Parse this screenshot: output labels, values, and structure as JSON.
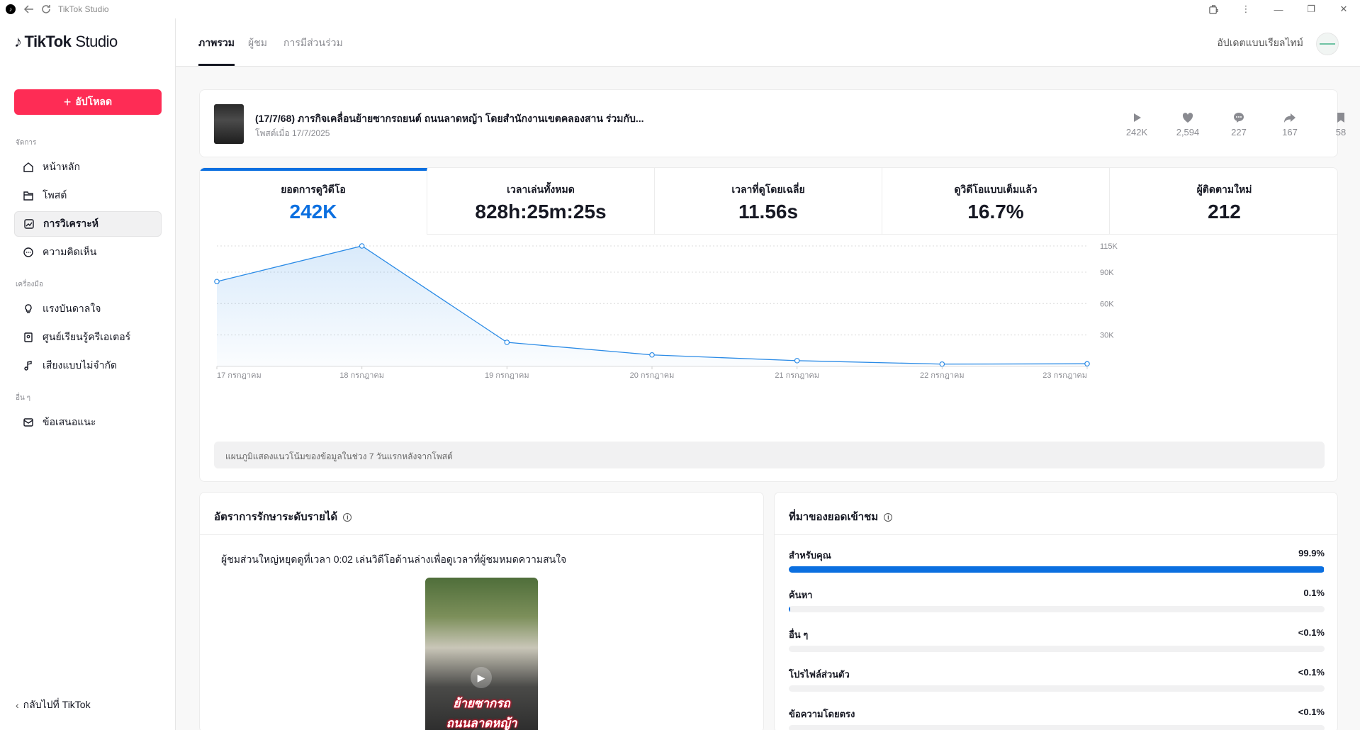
{
  "window": {
    "title": "TikTok Studio"
  },
  "sidebar": {
    "brand_main": "TikTok",
    "brand_sub": "Studio",
    "upload_label": "อัปโหลด",
    "section_manage": "จัดการ",
    "section_tools": "เครื่องมือ",
    "section_other": "อื่น ๆ",
    "items": [
      {
        "label": "หน้าหลัก"
      },
      {
        "label": "โพสต์"
      },
      {
        "label": "การวิเคราะห์"
      },
      {
        "label": "ความคิดเห็น"
      },
      {
        "label": "แรงบันดาลใจ"
      },
      {
        "label": "ศูนย์เรียนรู้ครีเอเตอร์"
      },
      {
        "label": "เสียงแบบไม่จำกัด"
      },
      {
        "label": "ข้อเสนอแนะ"
      }
    ],
    "back_label": "กลับไปที่ TikTok"
  },
  "topnav": {
    "tabs": [
      {
        "label": "ภาพรวม"
      },
      {
        "label": "ผู้ชม"
      },
      {
        "label": "การมีส่วนร่วม"
      }
    ],
    "live_update": "อัปเดตแบบเรียลไทม์"
  },
  "post": {
    "title": "(17/7/68) ภารกิจเคลื่อนย้ายซากรถยนต์ ถนนลาดหญ้า โดยสำนักงานเขตคลองสาน ร่วมกับ...",
    "date": "โพสต์เมื่อ 17/7/2025",
    "stats": {
      "views": "242K",
      "likes": "2,594",
      "comments": "227",
      "shares": "167",
      "saves": "58"
    }
  },
  "metrics": [
    {
      "label": "ยอดการดูวิดีโอ",
      "value": "242K"
    },
    {
      "label": "เวลาเล่นทั้งหมด",
      "value": "828h:25m:25s"
    },
    {
      "label": "เวลาที่ดูโดยเฉลี่ย",
      "value": "11.56s"
    },
    {
      "label": "ดูวิดีโอแบบเต็มแล้ว",
      "value": "16.7%"
    },
    {
      "label": "ผู้ติดตามใหม่",
      "value": "212"
    }
  ],
  "chart_note": "แผนภูมิแสดงแนวโน้มของข้อมูลในช่วง 7 วันแรกหลังจากโพสต์",
  "chart_data": {
    "type": "area",
    "x": [
      "17 กรกฎาคม",
      "18 กรกฎาคม",
      "19 กรกฎาคม",
      "20 กรกฎาคม",
      "21 กรกฎาคม",
      "22 กรกฎาคม",
      "23 กรกฎาคม"
    ],
    "series": [
      {
        "values": [
          81000,
          115000,
          23000,
          11000,
          5500,
          2200,
          2500
        ]
      }
    ],
    "y_ticks": [
      30000,
      60000,
      90000,
      115000
    ],
    "y_tick_labels": [
      "30K",
      "60K",
      "90K",
      "115K"
    ],
    "ylim": [
      0,
      115000
    ],
    "grid": true,
    "color": "#2b8be6"
  },
  "retention": {
    "title": "อัตราการรักษาระดับรายได้",
    "text": "ผู้ชมส่วนใหญ่หยุดดูที่เวลา 0:02 เล่นวิดีโอด้านล่างเพื่อดูเวลาที่ผู้ชมหมดความสนใจ",
    "thumb_caption_1": "ย้ายซากรถ",
    "thumb_caption_2": "ถนนลาดหญ้า"
  },
  "traffic": {
    "title": "ที่มาของยอดเข้าชม",
    "sources": [
      {
        "label": "สำหรับคุณ",
        "pct": "99.9%",
        "fraction": 0.999
      },
      {
        "label": "ค้นหา",
        "pct": "0.1%",
        "fraction": 0.002
      },
      {
        "label": "อื่น ๆ",
        "pct": "<0.1%",
        "fraction": 0
      },
      {
        "label": "โปรไฟล์ส่วนตัว",
        "pct": "<0.1%",
        "fraction": 0
      },
      {
        "label": "ข้อความโดยตรง",
        "pct": "<0.1%",
        "fraction": 0
      }
    ]
  },
  "colors": {
    "accent": "#fe2c55",
    "chart_blue": "#0b6fe0"
  }
}
